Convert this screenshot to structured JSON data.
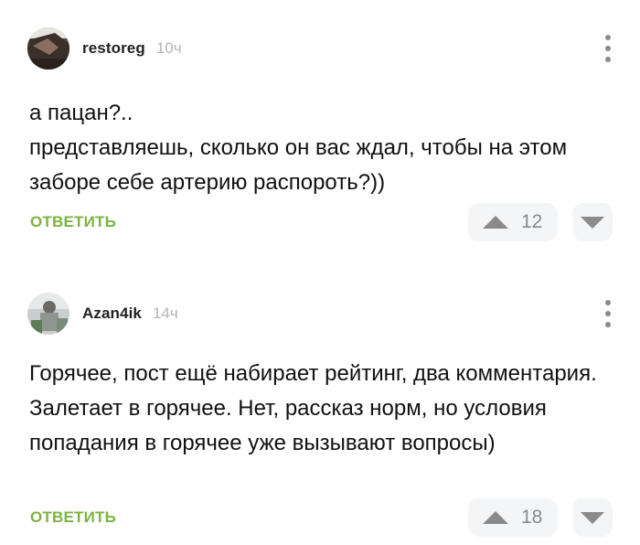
{
  "comments": [
    {
      "username": "restoreg",
      "time": "10ч",
      "avatar_icon": "user-avatar",
      "lines": [
        "а пацан?..",
        "представляешь, сколько он вас ждал, чтобы на этом заборе себе артерию распороть?))"
      ],
      "reply_label": "ОТВЕТИТЬ",
      "rating": "12"
    },
    {
      "username": "Azan4ik",
      "time": "14ч",
      "avatar_icon": "user-avatar",
      "lines": [
        "Горячее, пост ещё набирает рейтинг, два комментария. Залетает в горячее. Нет, рассказ норм, но условия попадания в горячее уже вызывают вопросы)"
      ],
      "reply_label": "ОТВЕТИТЬ",
      "rating": "18"
    }
  ],
  "colors": {
    "accent_green": "#7cb342",
    "muted_gray": "#8a8a8a",
    "time_gray": "#b5b5b5",
    "vote_bg": "#f4f5f6"
  },
  "icons": {
    "menu": "kebab-menu-icon",
    "upvote": "arrow-up-icon",
    "downvote": "arrow-down-icon"
  }
}
